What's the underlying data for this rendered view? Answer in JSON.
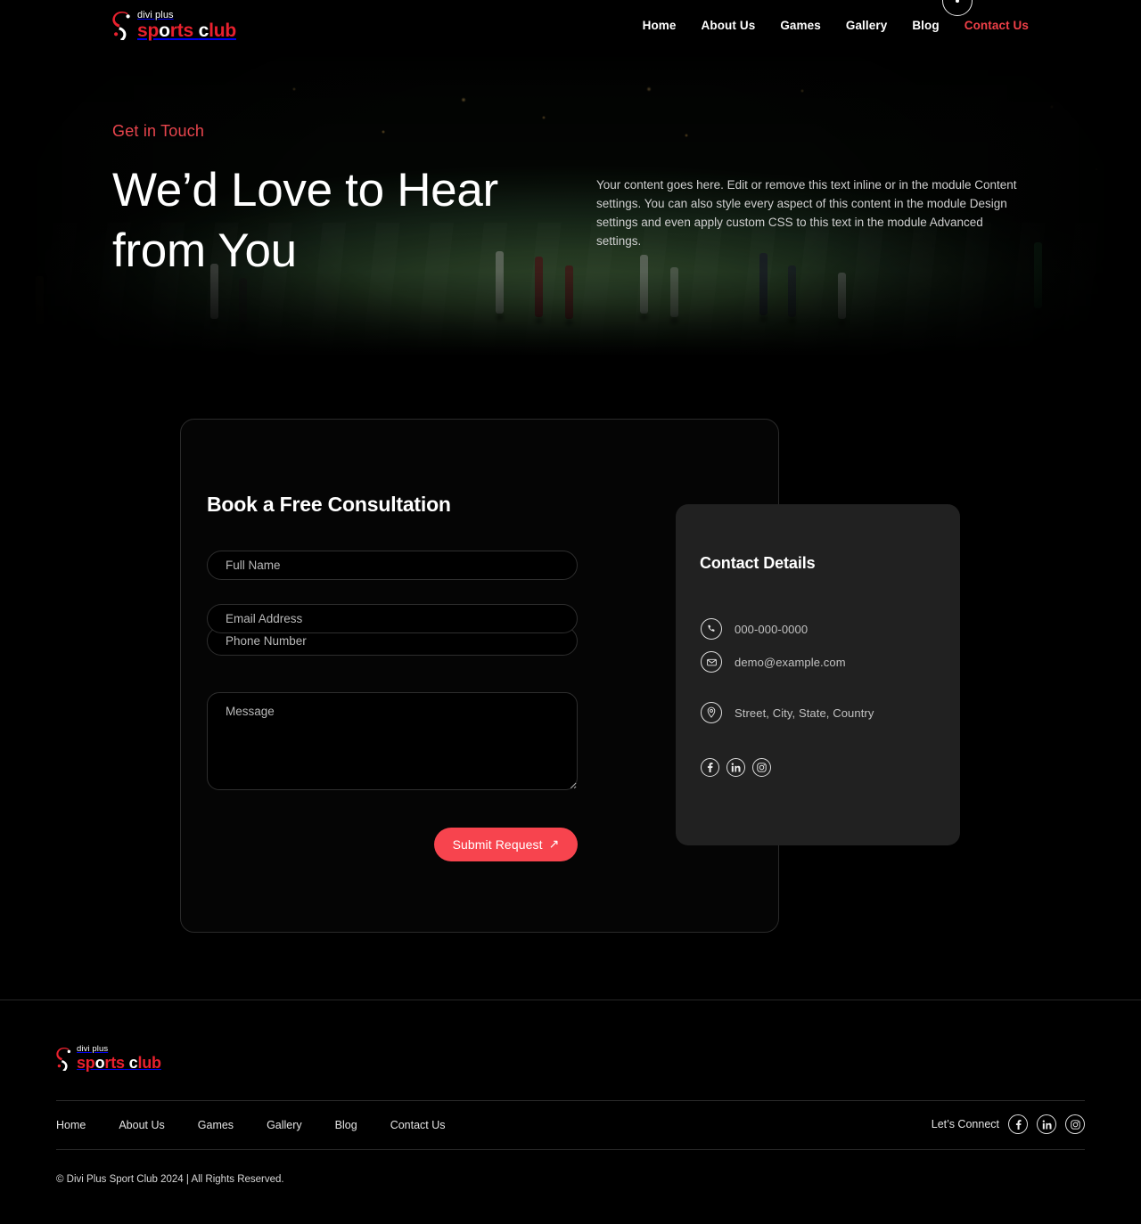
{
  "brand": {
    "logo_top": "divi plus",
    "logo_sp": "sp",
    "logo_o": "o",
    "logo_rts": "rts",
    "logo_space": " ",
    "logo_c": "c",
    "logo_lub": "lub",
    "accent_red": "#F7444E",
    "logo_red": "#E8212E"
  },
  "header": {
    "nav": [
      {
        "label": "Home",
        "active": false
      },
      {
        "label": "About Us",
        "active": false
      },
      {
        "label": "Games",
        "active": false
      },
      {
        "label": "Gallery",
        "active": false
      },
      {
        "label": "Blog",
        "active": false
      },
      {
        "label": "Contact Us",
        "active": true
      }
    ]
  },
  "hero": {
    "eyebrow": "Get in Touch",
    "title": "We’d Love to Hear from You",
    "description": "Your content goes here. Edit or remove this text inline or in the module Content settings. You can also style every aspect of this content in the module Design settings and even apply custom CSS to this text in the module Advanced settings."
  },
  "form": {
    "title": "Book a Free Consultation",
    "fields": {
      "name_placeholder": "Full Name",
      "email_placeholder": "Email Address",
      "phone_placeholder": "Phone Number",
      "message_placeholder": "Message"
    },
    "submit_label": "Submit Request",
    "submit_arrow": "↗"
  },
  "details": {
    "title": "Contact Details",
    "phone": "000-000-0000",
    "email": "demo@example.com",
    "address": "Street, City, State, Country",
    "socials": [
      {
        "name": "facebook-icon"
      },
      {
        "name": "linkedin-icon"
      },
      {
        "name": "instagram-icon"
      }
    ]
  },
  "footer": {
    "nav": [
      {
        "label": "Home"
      },
      {
        "label": "About Us"
      },
      {
        "label": "Games"
      },
      {
        "label": "Gallery"
      },
      {
        "label": "Blog"
      },
      {
        "label": "Contact Us"
      }
    ],
    "connect_label": "Let’s Connect",
    "copyright": "© Divi Plus Sport Club 2024 | All Rights Reserved."
  }
}
